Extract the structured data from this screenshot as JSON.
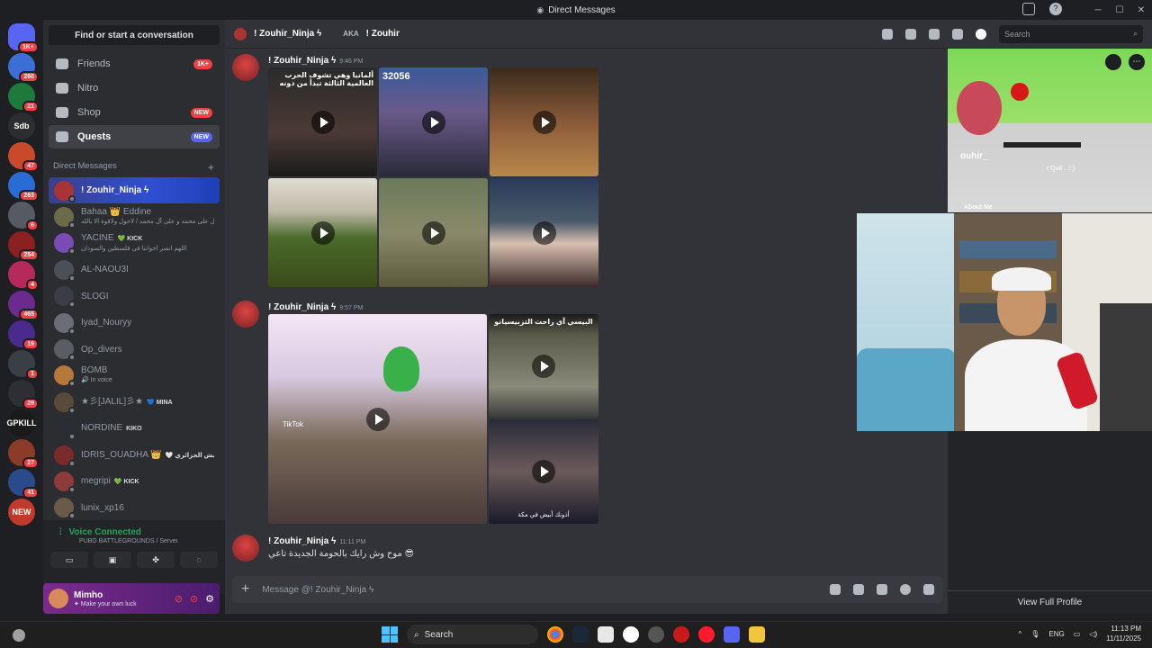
{
  "window": {
    "title": "Direct Messages"
  },
  "servers": [
    {
      "badge": "1K+",
      "color": "#5865f2"
    },
    {
      "badge": "260",
      "color": "#3b6fd6"
    },
    {
      "badge": "21",
      "color": "#1d7a3a"
    },
    {
      "badge": "",
      "label": "Sdb",
      "color": "#2b2d31"
    },
    {
      "badge": "47",
      "color": "#c84a2a"
    },
    {
      "badge": "263",
      "color": "#2a6cd6"
    },
    {
      "badge": "6",
      "color": "#555a63"
    },
    {
      "badge": "254",
      "color": "#8c1f1f"
    },
    {
      "badge": "4",
      "color": "#b52a5a"
    },
    {
      "badge": "465",
      "color": "#6b2a8c"
    },
    {
      "badge": "19",
      "color": "#4a2a8c"
    },
    {
      "badge": "1",
      "color": "#3a3f46"
    },
    {
      "badge": "29",
      "color": "#2d2f34"
    },
    {
      "badge": "",
      "label": "GPKILL",
      "color": "#1a1a1a"
    },
    {
      "badge": "27",
      "color": "#8c3a2a"
    },
    {
      "badge": "41",
      "color": "#2a4a8c"
    },
    {
      "badge": "",
      "label": "NEW",
      "color": "#c0392b"
    }
  ],
  "sidebar": {
    "finder": "Find or start a conversation",
    "nav": [
      {
        "label": "Friends",
        "pill": "1K+",
        "pill_color": "red"
      },
      {
        "label": "Nitro",
        "pill": "",
        "pill_color": ""
      },
      {
        "label": "Shop",
        "pill": "NEW",
        "pill_color": "red"
      },
      {
        "label": "Quests",
        "pill": "NEW",
        "pill_color": "blue"
      }
    ],
    "dm_header": "Direct Messages",
    "dm_add": "+",
    "dms": [
      {
        "name": "! Zouhir_Ninja ϟ",
        "sub": "",
        "tag": "",
        "color": "#a33"
      },
      {
        "name": "Bahaa 👑 Eddine",
        "sub": "صل على محمد و على آل محمد / لاحول ولاقوة الا بالله",
        "tag": "",
        "color": "#6b6b4a"
      },
      {
        "name": "YACINE",
        "sub": "اللهم انصر اخواننا في فلسطين والسودان",
        "tag": "💚 KICK",
        "color": "#7a4ab5"
      },
      {
        "name": "AL-NAOU3I",
        "sub": "",
        "tag": "",
        "color": "#4a4f58"
      },
      {
        "name": "SLOGI",
        "sub": "",
        "tag": "",
        "color": "#3a3d43"
      },
      {
        "name": "Iyad_Nouryy",
        "sub": "",
        "tag": "",
        "color": "#6a6d73"
      },
      {
        "name": "Op_divers",
        "sub": "",
        "tag": "",
        "color": "#5a5d63"
      },
      {
        "name": "BOMB",
        "sub": "🔊 In voice",
        "tag": "",
        "color": "#b5773a"
      },
      {
        "name": "★彡[JALIL]彡★",
        "sub": "",
        "tag": "💙 MINA",
        "color": "#5a4a3a"
      },
      {
        "name": "NORDINE",
        "sub": "",
        "tag": "KIKO",
        "color": "#2a2d33"
      },
      {
        "name": "IDRIS_OUADHA 👑",
        "sub": "",
        "tag": "🤍 الجيش الجزائري",
        "color": "#7a2a2a"
      },
      {
        "name": "megripi",
        "sub": "",
        "tag": "💚 KICK",
        "color": "#8c3a3a"
      },
      {
        "name": "lunix_xp16",
        "sub": "",
        "tag": "",
        "color": "#6a5a4a"
      }
    ],
    "voice": {
      "status": "Voice Connected",
      "server": "PUBG BATTLEGROUNDS / Serveur de b..."
    },
    "user": {
      "name": "Mimho",
      "status": "✦ Make your own luck"
    }
  },
  "chat": {
    "header_name": "! Zouhir_Ninja ϟ",
    "aka_label": "AKA",
    "aka_name": "! Zouhir",
    "search_placeholder": "Search",
    "messages": [
      {
        "author": "! Zouhir_Ninja ϟ",
        "time": "9:46 PM"
      },
      {
        "author": "! Zouhir_Ninja ϟ",
        "time": "9:57 PM"
      },
      {
        "author": "! Zouhir_Ninja ϟ",
        "time": "11:11 PM",
        "text": "موح وش رايك بالحومة الجديدة تاعي 😎"
      }
    ],
    "tile_texts": {
      "t1": "ألمانيا وهي تشوف الحرب العالمية الثالثة تبدأ من دونه",
      "t2": "32056",
      "t8": "البيسي آي راحت التزبيسيانو",
      "t9": "أذونك أبيض في مكة",
      "tiktok": "TikTok"
    },
    "composer_placeholder": "Message @! Zouhir_Ninja ϟ"
  },
  "profile": {
    "about_label": "About Me",
    "view_full": "View Full Profile",
    "banner_text": "ouhir_",
    "banner_sub": "r Quit ...!:)"
  },
  "taskbar": {
    "search": "Search",
    "lang": "ENG",
    "time": "11:13 PM",
    "date": "11/11/2025"
  }
}
